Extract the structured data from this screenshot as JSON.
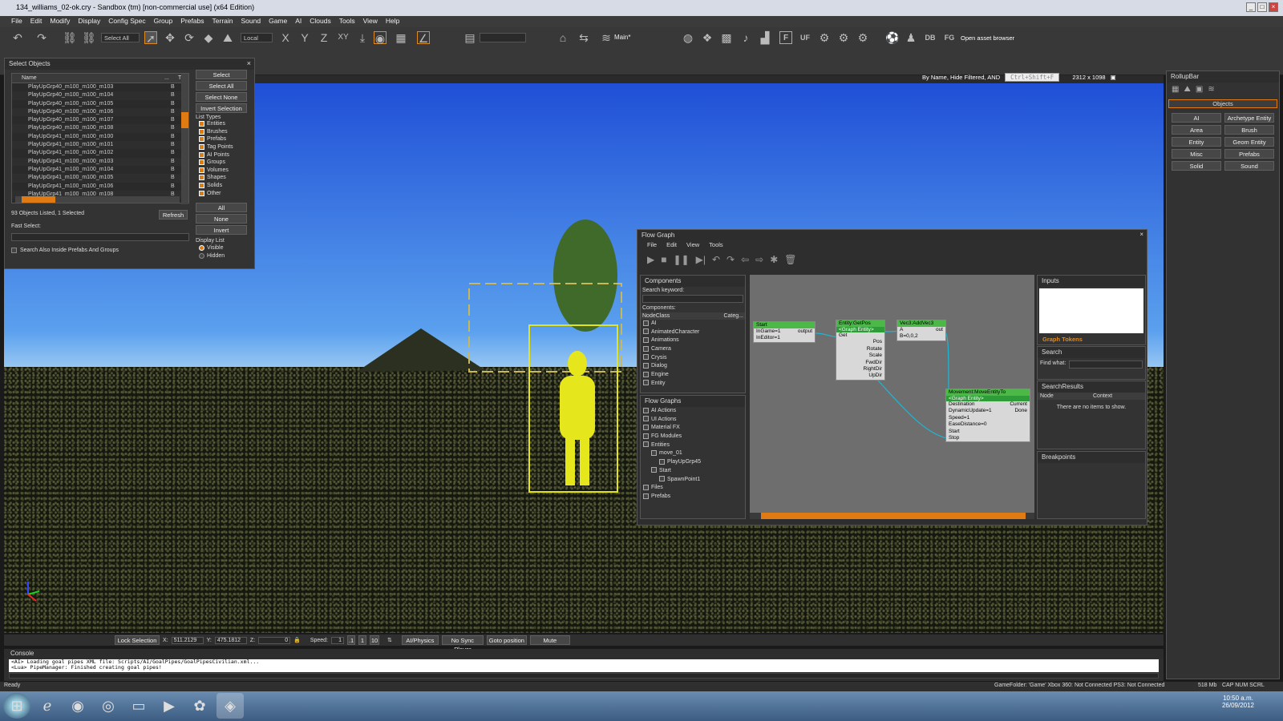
{
  "window": {
    "title": "134_williams_02-ok.cry - Sandbox (tm) [non-commercial use] (x64 Edition)"
  },
  "menu": [
    "File",
    "Edit",
    "Modify",
    "Display",
    "Config Spec",
    "Group",
    "Prefabs",
    "Terrain",
    "Sound",
    "Game",
    "AI",
    "Clouds",
    "Tools",
    "View",
    "Help"
  ],
  "toolbar": {
    "select_all": "Select All",
    "coord": "Local",
    "axes": [
      "X",
      "Y",
      "Z",
      "XY"
    ],
    "layer": "Main*",
    "labels": [
      "F",
      "UF",
      "DB",
      "FG"
    ],
    "asset_browser": "Open asset browser"
  },
  "viewport": {
    "filter": "By Name, Hide Filtered, AND",
    "search_placeholder": "Ctrl+Shift+F",
    "resolution": "2312 x 1098"
  },
  "select_objects": {
    "title": "Select Objects",
    "col_name": "Name",
    "col_type": "T",
    "col_dots": "...",
    "rows": [
      "PlayUpGrp40_m100_m100_m103",
      "PlayUpGrp40_m100_m100_m104",
      "PlayUpGrp40_m100_m100_m105",
      "PlayUpGrp40_m100_m100_m106",
      "PlayUpGrp40_m100_m100_m107",
      "PlayUpGrp40_m100_m100_m108",
      "PlayUpGrp41_m100_m100_m100",
      "PlayUpGrp41_m100_m100_m101",
      "PlayUpGrp41_m100_m100_m102",
      "PlayUpGrp41_m100_m100_m103",
      "PlayUpGrp41_m100_m100_m104",
      "PlayUpGrp41_m100_m100_m105",
      "PlayUpGrp41_m100_m100_m106",
      "PlayUpGrp41_m100_m100_m108"
    ],
    "row_type": "B",
    "status": "93 Objects Listed,   1 Selected",
    "refresh": "Refresh",
    "fast_select": "Fast Select:",
    "search_prefabs": "Search Also Inside Prefabs And Groups",
    "buttons": [
      "Select",
      "Select All",
      "Select None",
      "Invert Selection"
    ],
    "list_types_title": "List Types",
    "list_types": [
      "Entities",
      "Brushes",
      "Prefabs",
      "Tag Points",
      "AI Points",
      "Groups",
      "Volumes",
      "Shapes",
      "Solids",
      "Other"
    ],
    "type_buttons": [
      "All",
      "None",
      "Invert"
    ],
    "display_title": "Display List",
    "display_opts": [
      "Visible",
      "Hidden"
    ]
  },
  "flowgraph": {
    "title": "Flow Graph",
    "menu": [
      "File",
      "Edit",
      "View",
      "Tools"
    ],
    "components": {
      "title": "Components",
      "search": "Search keyword:",
      "label": "Components:",
      "col1": "NodeClass",
      "col2": "Categ...",
      "items": [
        "AI",
        "AnimatedCharacter",
        "Animations",
        "Camera",
        "Crysis",
        "Dialog",
        "Engine",
        "Entity"
      ]
    },
    "graphs": {
      "title": "Flow Graphs",
      "items": [
        "AI Actions",
        "UI Actions",
        "Material FX",
        "FG Modules",
        "Entities",
        "move_01",
        "PlayUpGrp45",
        "Start",
        "SpawnPoint1",
        "Files",
        "Prefabs"
      ]
    },
    "nodes": {
      "start": {
        "title": "Start",
        "ports": [
          "InGame=1",
          "InEditor=1"
        ],
        "out": "output"
      },
      "getpos": {
        "title": "Entity:GetPos",
        "target": "<Graph Entity>",
        "in": "Get",
        "outs": [
          "Pos",
          "Rotate",
          "Scale",
          "FwdDir",
          "RightDir",
          "UpDir"
        ]
      },
      "addvec": {
        "title": "Vec3:AddVec3",
        "ins": [
          "A",
          "B=0,0,2"
        ],
        "out": "out"
      },
      "move": {
        "title": "Movement:MoveEntityTo",
        "target": "<Graph Entity>",
        "ins": [
          "Destination",
          "DynamicUpdate=1",
          "Speed=1",
          "EaseDistance=0",
          "Start",
          "Stop"
        ],
        "outs": [
          "Current",
          "Done"
        ]
      }
    },
    "inputs": {
      "title": "Inputs",
      "tokens": "Graph Tokens"
    },
    "search": {
      "title": "Search",
      "find": "Find what:"
    },
    "results": {
      "title": "SearchResults",
      "col1": "Node",
      "col2": "Context",
      "empty": "There are no items to show."
    },
    "breakpoints": {
      "title": "Breakpoints"
    }
  },
  "rollup": {
    "title": "RollupBar",
    "section": "Objects",
    "buttons": [
      "AI",
      "Archetype Entity",
      "Area",
      "Brush",
      "Entity",
      "Geom Entity",
      "Misc",
      "Prefabs",
      "Solid",
      "Sound"
    ]
  },
  "bottom": {
    "lock": "Lock Selection",
    "x_label": "X:",
    "x": "511.2129",
    "y_label": "Y:",
    "y": "475.1812",
    "z_label": "Z:",
    "z": "0",
    "speed_label": "Speed:",
    "speed": "1",
    "speeds": [
      ".1",
      "1",
      "10"
    ],
    "buttons": [
      "AI/Physics",
      "No Sync Player",
      "Goto position",
      "Mute"
    ]
  },
  "console": {
    "title": "Console",
    "lines": [
      "<AI> Loading goal pipes XML file: Scripts/AI/GoalPipes/GoalPipesCivilian.xml...",
      "<Lua> PipeManager: Finished creating goal pipes!"
    ]
  },
  "status": {
    "ready": "Ready",
    "right": "GameFolder: 'Game'   Xbox 360: Not Connected   PS3: Not Connected",
    "mem": "518 Mb",
    "keys": "CAP  NUM  SCRL"
  },
  "taskbar": {
    "time": "10:50 a.m.",
    "date": "26/09/2012"
  }
}
